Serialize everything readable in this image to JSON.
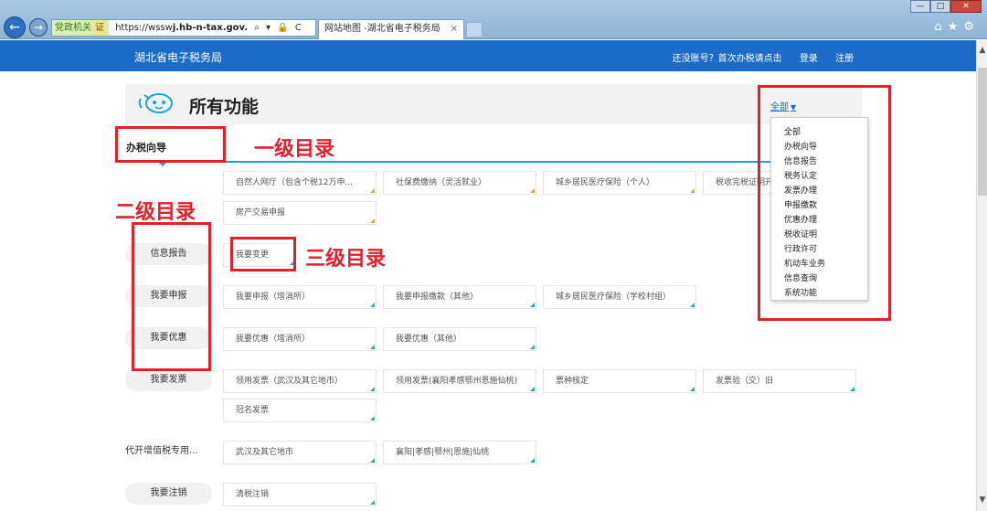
{
  "browser": {
    "back_icon": "arrow-left-icon",
    "address_badge": "党政机关",
    "address_badge_mark": "证",
    "url_prefix": "https://wssw",
    "url_host": "j.hb-n-tax.gov.",
    "address_tools": "⌕ ▾ 🔒 C",
    "tab_title": "网站地图 -湖北省电子税务局",
    "tab_close": "×"
  },
  "site": {
    "title": "湖北省电子税务局",
    "register_hint": "还没账号？首次办税请点击",
    "login": "登录",
    "signup": "注册"
  },
  "panel": {
    "title": "所有功能",
    "filter_label": "全部",
    "guide_label": "办税向导"
  },
  "dropdown": {
    "options": [
      "全部",
      "办税向导",
      "信息报告",
      "税务认定",
      "发票办理",
      "申报缴款",
      "优惠办理",
      "税收证明",
      "行政许可",
      "机动车业务",
      "信息查询",
      "系统功能"
    ]
  },
  "rows": {
    "guide_items": [
      "自然人网厅（包含个税12万申...",
      "社保费缴纳（灵活就业）",
      "城乡居民医疗保险（个人）",
      "税收完税证明开具",
      "房产交易申报"
    ],
    "info_report": {
      "label": "信息报告",
      "items": [
        "我要变更"
      ]
    },
    "declare": {
      "label": "我要申报",
      "items": [
        "我要申报（增消所）",
        "我要申报缴款（其他）",
        "城乡居民医疗保险（学校村组）"
      ]
    },
    "preferential": {
      "label": "我要优惠",
      "items": [
        "我要优惠（增消所）",
        "我要优惠（其他）"
      ]
    },
    "invoice": {
      "label": "我要发票",
      "items": [
        "领用发票（武汉及其它地市）",
        "领用发票(襄阳孝感鄂州恩施仙桃)",
        "票种核定",
        "发票验（交）旧",
        "冠名发票"
      ]
    },
    "vat_agent": {
      "label": "代开增值税专用...",
      "items": [
        "武汉及其它地市",
        "襄阳|孝感|鄂州|恩施|仙桃"
      ]
    },
    "cancel": {
      "label": "我要注销",
      "items": [
        "清税注销"
      ]
    }
  },
  "annotations": {
    "level1": "一级目录",
    "level2": "二级目录",
    "level3": "三级目录"
  },
  "colors": {
    "brand_blue": "#1d6bc8",
    "annotation_red": "#e41e2b",
    "accent_teal": "#22a0d2"
  }
}
